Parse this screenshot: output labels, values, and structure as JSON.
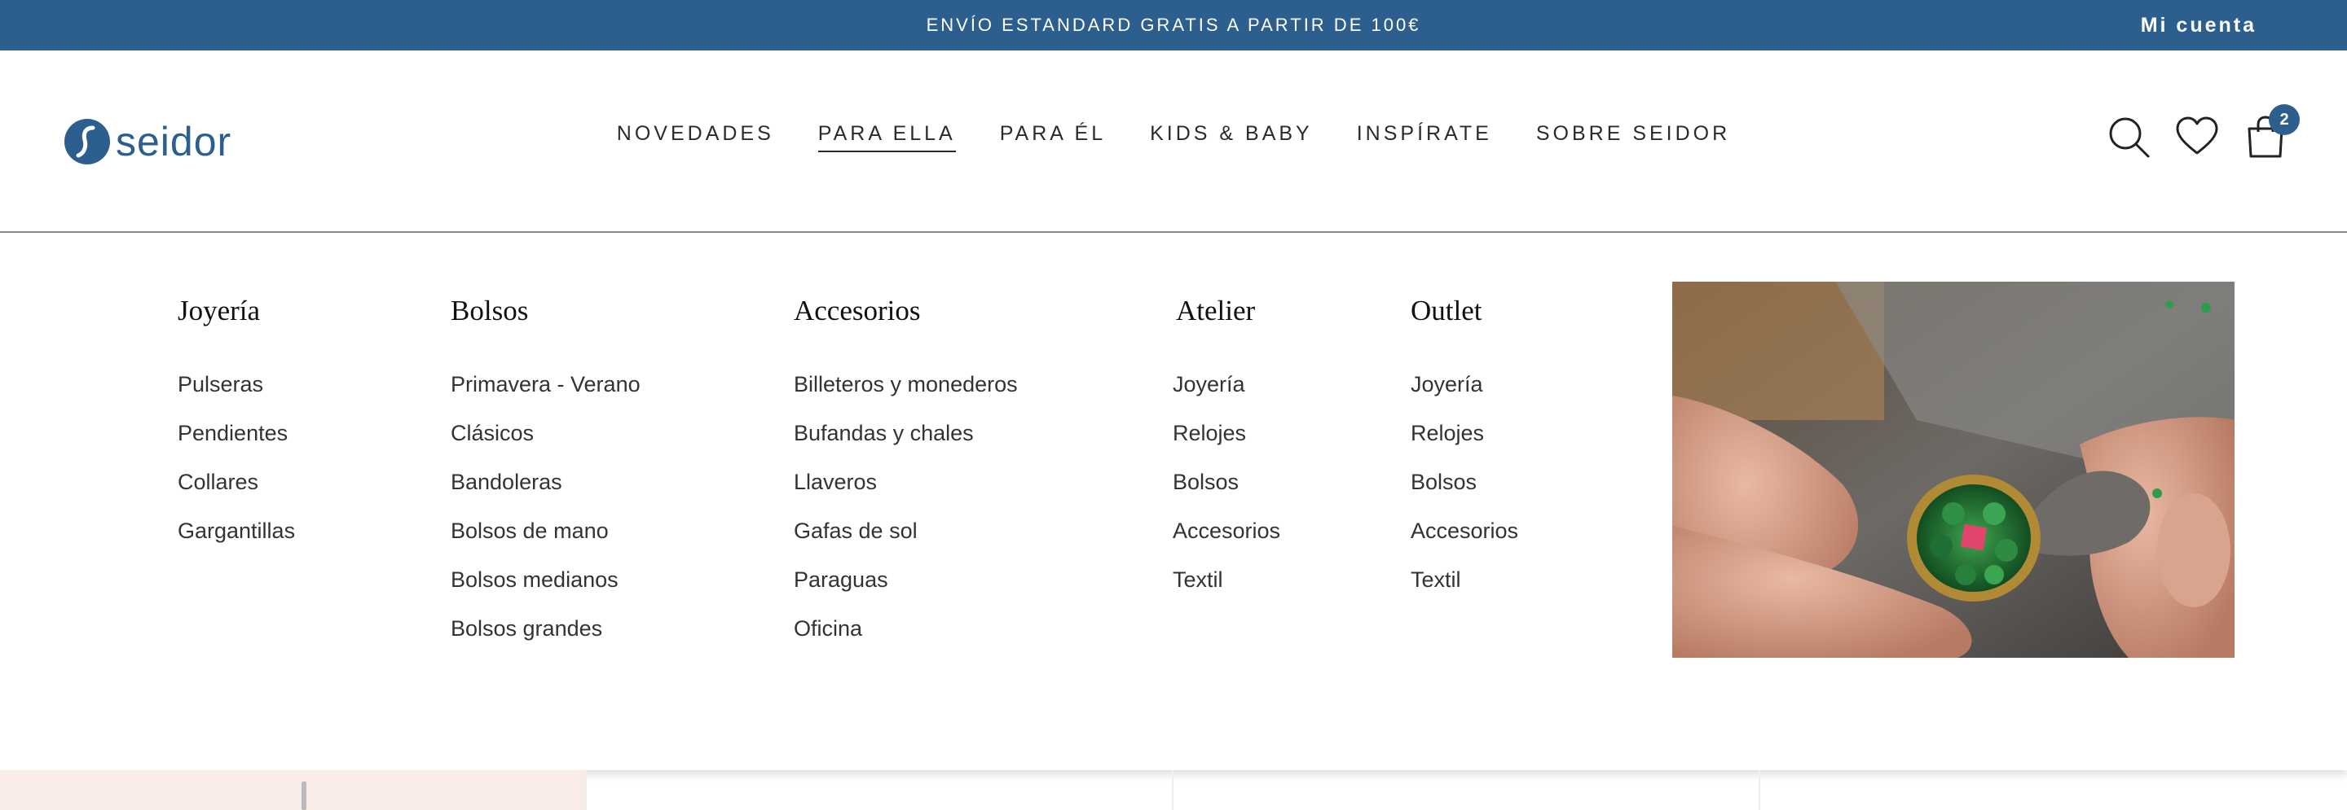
{
  "topbar": {
    "promo": "ENVÍO ESTANDARD GRATIS A PARTIR DE 100€",
    "account": "Mi cuenta",
    "bg_color": "#2c5f8e"
  },
  "brand": {
    "name": "seidor",
    "color": "#2c5f8e"
  },
  "nav": {
    "items": [
      "NOVEDADES",
      "PARA ELLA",
      "PARA ÉL",
      "KIDS & BABY",
      "INSPÍRATE",
      "SOBRE SEIDOR"
    ],
    "active": "PARA ELLA"
  },
  "header_icons": {
    "search": "search-icon",
    "wishlist": "heart-icon",
    "cart": "shopping-bag-icon",
    "cart_count": "2"
  },
  "menu": {
    "columns": [
      {
        "title": "Joyería",
        "links": [
          "Pulseras",
          "Pendientes",
          "Collares",
          "Gargantillas"
        ]
      },
      {
        "title": "Bolsos",
        "links": [
          "Primavera - Verano",
          "Clásicos",
          "Bandoleras",
          "Bolsos de mano",
          "Bolsos medianos",
          "Bolsos grandes"
        ]
      },
      {
        "title": "Accesorios",
        "links": [
          "Billeteros y monederos",
          "Bufandas y chales",
          "Llaveros",
          "Gafas de sol",
          "Paraguas",
          "Oficina"
        ]
      },
      {
        "title": "Atelier",
        "links": [
          "Joyería",
          "Relojes",
          "Bolsos",
          "Accesorios",
          "Textil"
        ]
      },
      {
        "title": "Outlet",
        "links": [
          "Joyería",
          "Relojes",
          "Bolsos",
          "Accesorios",
          "Textil"
        ]
      }
    ],
    "featured_image": "ring-atelier-photo"
  }
}
